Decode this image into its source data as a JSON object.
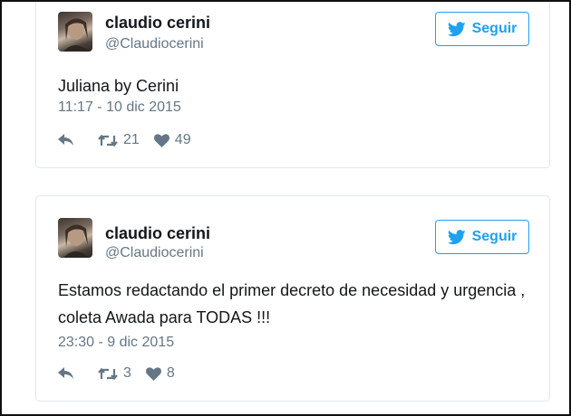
{
  "colors": {
    "accent": "#1da1f2",
    "text": "#14171a",
    "muted": "#657786",
    "border": "#e1e8ed"
  },
  "tweets": [
    {
      "author": {
        "name": "claudio cerini",
        "handle": "@Claudiocerini"
      },
      "follow_label": "Seguir",
      "text": "Juliana by Cerini",
      "timestamp": "11:17 - 10 dic 2015",
      "retweets": "21",
      "likes": "49"
    },
    {
      "author": {
        "name": "claudio cerini",
        "handle": "@Claudiocerini"
      },
      "follow_label": "Seguir",
      "text": "Estamos redactando el primer decreto de necesidad y urgencia , coleta Awada para TODAS !!!",
      "timestamp": "23:30 - 9 dic 2015",
      "retweets": "3",
      "likes": "8"
    }
  ],
  "icons": {
    "follow": "twitter-bird-icon",
    "reply": "reply-icon",
    "retweet": "retweet-icon",
    "like": "heart-icon"
  }
}
